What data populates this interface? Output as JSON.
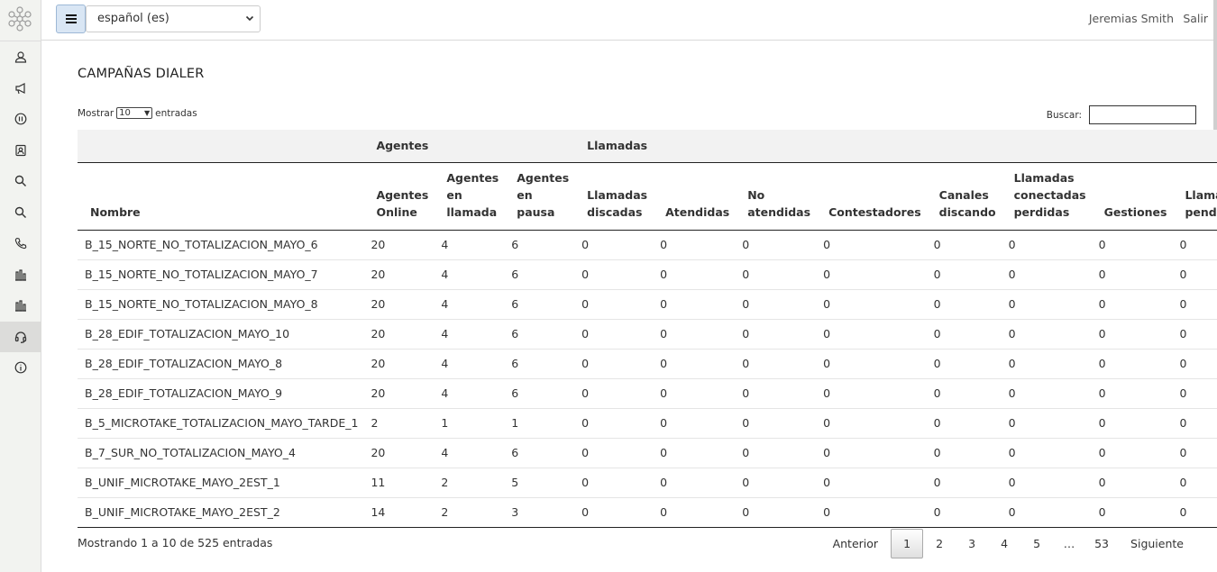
{
  "topbar": {
    "language": "español (es)",
    "user_name": "Jeremias Smith",
    "logout": "Salir"
  },
  "sidebar": {
    "items": [
      {
        "icon": "user-icon"
      },
      {
        "icon": "megaphone-icon"
      },
      {
        "icon": "pause-icon"
      },
      {
        "icon": "contacts-icon"
      },
      {
        "icon": "search-icon"
      },
      {
        "icon": "search-icon"
      },
      {
        "icon": "phone-icon"
      },
      {
        "icon": "bar-chart-icon"
      },
      {
        "icon": "bar-chart-icon"
      },
      {
        "icon": "headset-icon",
        "active": true
      },
      {
        "icon": "info-icon"
      }
    ]
  },
  "page": {
    "title": "CAMPAÑAS DIALER",
    "show_label": "Mostrar",
    "show_value": "10",
    "entries_label": "entradas",
    "search_label": "Buscar:",
    "search_value": ""
  },
  "table": {
    "group_headers": {
      "agentes": "Agentes",
      "llamadas": "Llamadas"
    },
    "columns": [
      "Nombre",
      "Agentes Online",
      "Agentes en llamada",
      "Agentes en pausa",
      "Llamadas discadas",
      "Atendidas",
      "No atendidas",
      "Contestadores",
      "Canales discando",
      "Llamadas conectadas perdidas",
      "Gestiones",
      "Llamadas pendientes"
    ],
    "rows": [
      [
        "B_15_NORTE_NO_TOTALIZACION_MAYO_6",
        "20",
        "4",
        "6",
        "0",
        "0",
        "0",
        "0",
        "0",
        "0",
        "0",
        "0"
      ],
      [
        "B_15_NORTE_NO_TOTALIZACION_MAYO_7",
        "20",
        "4",
        "6",
        "0",
        "0",
        "0",
        "0",
        "0",
        "0",
        "0",
        "0"
      ],
      [
        "B_15_NORTE_NO_TOTALIZACION_MAYO_8",
        "20",
        "4",
        "6",
        "0",
        "0",
        "0",
        "0",
        "0",
        "0",
        "0",
        "0"
      ],
      [
        "B_28_EDIF_TOTALIZACION_MAYO_10",
        "20",
        "4",
        "6",
        "0",
        "0",
        "0",
        "0",
        "0",
        "0",
        "0",
        "0"
      ],
      [
        "B_28_EDIF_TOTALIZACION_MAYO_8",
        "20",
        "4",
        "6",
        "0",
        "0",
        "0",
        "0",
        "0",
        "0",
        "0",
        "0"
      ],
      [
        "B_28_EDIF_TOTALIZACION_MAYO_9",
        "20",
        "4",
        "6",
        "0",
        "0",
        "0",
        "0",
        "0",
        "0",
        "0",
        "0"
      ],
      [
        "B_5_MICROTAKE_TOTALIZACION_MAYO_TARDE_1",
        "2",
        "1",
        "1",
        "0",
        "0",
        "0",
        "0",
        "0",
        "0",
        "0",
        "0"
      ],
      [
        "B_7_SUR_NO_TOTALIZACION_MAYO_4",
        "20",
        "4",
        "6",
        "0",
        "0",
        "0",
        "0",
        "0",
        "0",
        "0",
        "0"
      ],
      [
        "B_UNIF_MICROTAKE_MAYO_2EST_1",
        "11",
        "2",
        "5",
        "0",
        "0",
        "0",
        "0",
        "0",
        "0",
        "0",
        "0"
      ],
      [
        "B_UNIF_MICROTAKE_MAYO_2EST_2",
        "14",
        "2",
        "3",
        "0",
        "0",
        "0",
        "0",
        "0",
        "0",
        "0",
        "0"
      ]
    ]
  },
  "footer": {
    "info": "Mostrando 1 a 10 de 525 entradas",
    "prev": "Anterior",
    "next": "Siguiente",
    "pages": [
      "1",
      "2",
      "3",
      "4",
      "5",
      "…",
      "53"
    ],
    "current_page": "1"
  }
}
